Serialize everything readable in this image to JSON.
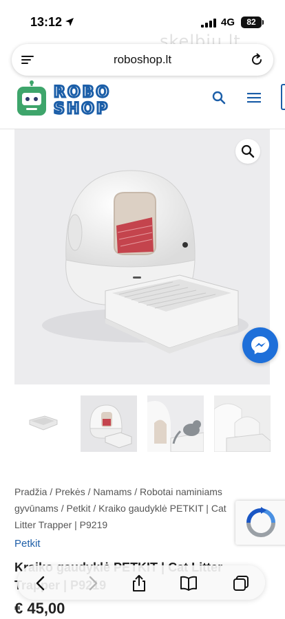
{
  "status_bar": {
    "time": "13:12",
    "network": "4G",
    "battery": "82"
  },
  "watermark": "skelbiu.lt",
  "browser": {
    "url": "roboshop.lt"
  },
  "site": {
    "logo_top": "ROBO",
    "logo_bottom": "SHOP",
    "accent_color": "#1b5ea8",
    "logo_green": "#3ea56b"
  },
  "breadcrumb": {
    "text": "Pradžia / Prekės / Namams / Robotai naminiams gyvūnams / Petkit / Kraiko gaudyklė PETKIT | Cat Litter Trapper | P9219"
  },
  "product": {
    "brand": "Petkit",
    "title": "Kraiko gaudyklė PETKIT | Cat Litter Trapper | P9219",
    "price": "€ 45,00"
  },
  "toolbar": {
    "icons": [
      "chevron-left-icon",
      "chevron-right-icon",
      "share-icon",
      "book-icon",
      "tabs-icon"
    ]
  }
}
